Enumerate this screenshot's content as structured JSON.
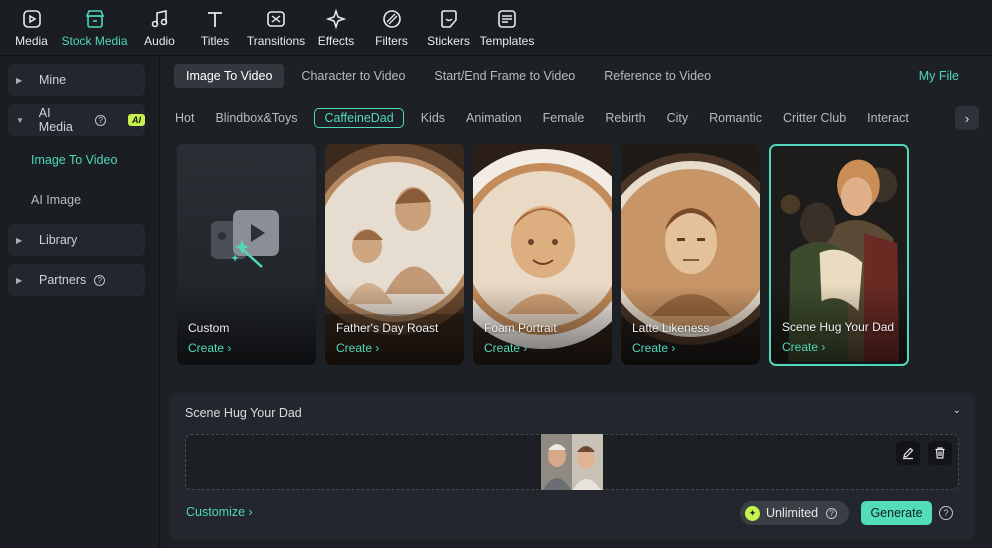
{
  "toolbar": {
    "items": [
      {
        "label": "Media",
        "icon": "media-icon",
        "active": false
      },
      {
        "label": "Stock Media",
        "icon": "stock-media-icon",
        "active": true
      },
      {
        "label": "Audio",
        "icon": "music-note-icon",
        "active": false
      },
      {
        "label": "Titles",
        "icon": "text-t-icon",
        "active": false
      },
      {
        "label": "Transitions",
        "icon": "transitions-icon",
        "active": false
      },
      {
        "label": "Effects",
        "icon": "sparkle-icon",
        "active": false
      },
      {
        "label": "Filters",
        "icon": "filter-icon",
        "active": false
      },
      {
        "label": "Stickers",
        "icon": "sticker-icon",
        "active": false
      },
      {
        "label": "Templates",
        "icon": "templates-icon",
        "active": false
      }
    ]
  },
  "sidebar": {
    "mine": "Mine",
    "ai_media": "AI Media",
    "ai_badge": "AI",
    "image_to_video": "Image To Video",
    "ai_image": "AI Image",
    "library": "Library",
    "partners": "Partners"
  },
  "modes": [
    "Image To Video",
    "Character to Video",
    "Start/End Frame to Video",
    "Reference to Video"
  ],
  "my_file": "My File",
  "categories": [
    "Hot",
    "Blindbox&Toys",
    "CaffeineDad",
    "Kids",
    "Animation",
    "Female",
    "Rebirth",
    "City",
    "Romantic",
    "Critter Club",
    "Interact"
  ],
  "active_category": "CaffeineDad",
  "cards": [
    {
      "name": "Custom",
      "create": "Create"
    },
    {
      "name": "Father's Day Roast",
      "create": "Create"
    },
    {
      "name": "Foam Portrait",
      "create": "Create"
    },
    {
      "name": "Latte Likeness",
      "create": "Create"
    },
    {
      "name": "Scene Hug Your Dad",
      "create": "Create"
    }
  ],
  "panel": {
    "title": "Scene Hug Your Dad",
    "customize": "Customize",
    "unlimited": "Unlimited",
    "generate": "Generate"
  },
  "colors": {
    "accent": "#4fd8b9",
    "ai_badge": "#c6f24e"
  }
}
